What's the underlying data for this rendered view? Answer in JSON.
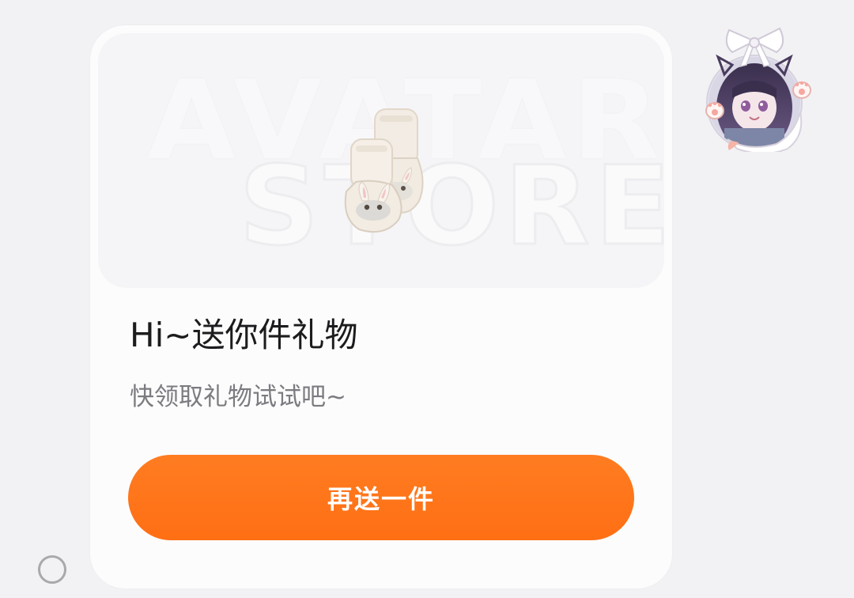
{
  "banner": {
    "watermark_line1": "AVATAR",
    "watermark_line2": "STORE",
    "image": "bunny-slippers-gift"
  },
  "gift": {
    "title": "Hi~送你件礼物",
    "subtitle": "快领取礼物试试吧~",
    "button_label": "再送一件"
  },
  "avatar": {
    "image": "anime-girl-with-bow-avatar"
  },
  "colors": {
    "accent": "#ff7318",
    "background": "#f2f2f4",
    "card": "#fcfcfd"
  }
}
